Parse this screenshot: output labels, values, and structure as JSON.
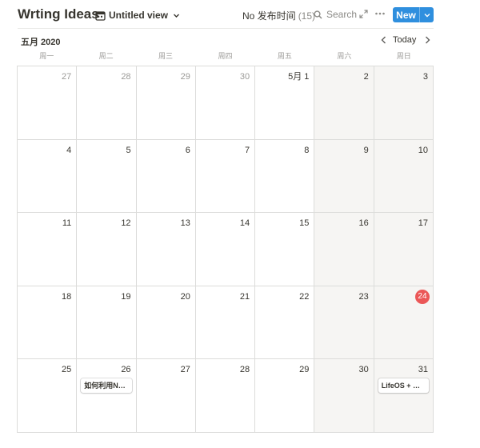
{
  "header": {
    "title": "Wrting Ideas",
    "view": {
      "label": "Untitled view",
      "icon": "calendar-icon"
    },
    "group_property": {
      "label": "No 发布时间",
      "count": "(15)"
    },
    "search_label": "Search",
    "new_label": "New"
  },
  "calendar": {
    "month_label": "五月 2020",
    "today_label": "Today",
    "weekdays": [
      "周一",
      "周二",
      "周三",
      "周四",
      "周五",
      "周六",
      "周日"
    ],
    "weeks": [
      [
        {
          "label": "27",
          "outside": true
        },
        {
          "label": "28",
          "outside": true
        },
        {
          "label": "29",
          "outside": true
        },
        {
          "label": "30",
          "outside": true
        },
        {
          "label": "5月 1"
        },
        {
          "label": "2"
        },
        {
          "label": "3"
        }
      ],
      [
        {
          "label": "4"
        },
        {
          "label": "5"
        },
        {
          "label": "6"
        },
        {
          "label": "7"
        },
        {
          "label": "8"
        },
        {
          "label": "9"
        },
        {
          "label": "10"
        }
      ],
      [
        {
          "label": "11"
        },
        {
          "label": "12"
        },
        {
          "label": "13"
        },
        {
          "label": "14"
        },
        {
          "label": "15"
        },
        {
          "label": "16"
        },
        {
          "label": "17"
        }
      ],
      [
        {
          "label": "18"
        },
        {
          "label": "19"
        },
        {
          "label": "20"
        },
        {
          "label": "21"
        },
        {
          "label": "22"
        },
        {
          "label": "23"
        },
        {
          "label": "24",
          "today": true
        }
      ],
      [
        {
          "label": "25"
        },
        {
          "label": "26",
          "event": "如何利用No..."
        },
        {
          "label": "27"
        },
        {
          "label": "28"
        },
        {
          "label": "29"
        },
        {
          "label": "30"
        },
        {
          "label": "31",
          "event": "LifeOS + 晨..."
        }
      ]
    ]
  },
  "colors": {
    "accent": "#2f8fde",
    "today_marker": "#eb5757",
    "weekend_bg": "#f6f5f3"
  }
}
